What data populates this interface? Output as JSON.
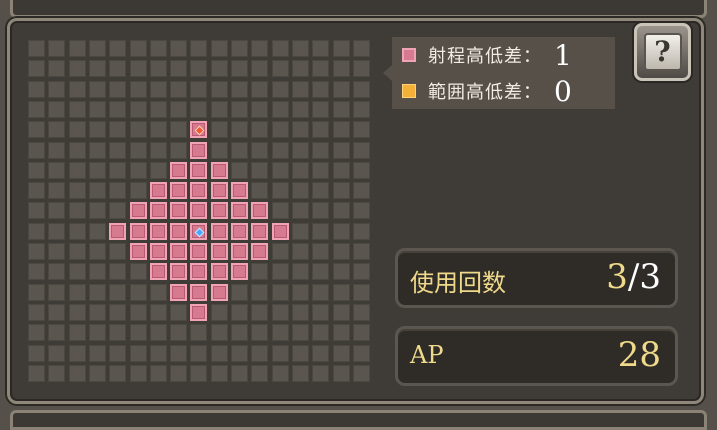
{
  "legend": {
    "range_height_label": "射程高低差：",
    "range_height_value": "1",
    "area_height_label": "範囲高低差：",
    "area_height_value": "0",
    "range_color": "#d67a90",
    "area_color": "#f3b13a"
  },
  "help_button": {
    "icon": "question-book-icon",
    "glyph": "?"
  },
  "uses": {
    "label": "使用回数",
    "current": "3",
    "separator": "/",
    "max": "3"
  },
  "ap": {
    "label": "AP",
    "value": "28"
  },
  "grid": {
    "cols": 17,
    "rows": 17,
    "range_radius": 4,
    "target_offset_rows": 4
  }
}
